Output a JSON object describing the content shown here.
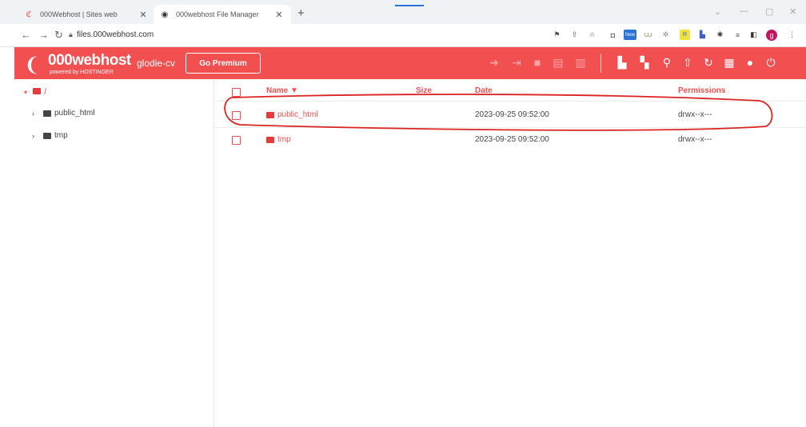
{
  "browser": {
    "tabs": [
      {
        "title": "000Webhost | Sites web",
        "active": false,
        "favicon": "000webhost-icon"
      },
      {
        "title": "000webhost File Manager",
        "active": true,
        "favicon": "globe-icon"
      }
    ],
    "new_tab": "+",
    "url": "files.000webhost.com",
    "ext_new_badge": "New",
    "profile_letter": "g"
  },
  "app": {
    "brand": "000webhost",
    "brand_sub": "powered by HOSTINGER",
    "site_name": "glodie-cv",
    "premium_label": "Go Premium",
    "accent": "#f14f50"
  },
  "sidebar": {
    "root": "/",
    "items": [
      {
        "label": "public_html"
      },
      {
        "label": "tmp"
      }
    ]
  },
  "table": {
    "headers": {
      "name": "Name ▼",
      "size": "Size",
      "date": "Date",
      "permissions": "Permissions"
    },
    "rows": [
      {
        "name": "public_html",
        "size": "",
        "date": "2023-09-25 09:52:00",
        "permissions": "drwx--x---"
      },
      {
        "name": "tmp",
        "size": "",
        "date": "2023-09-25 09:52:00",
        "permissions": "drwx--x---"
      }
    ]
  }
}
